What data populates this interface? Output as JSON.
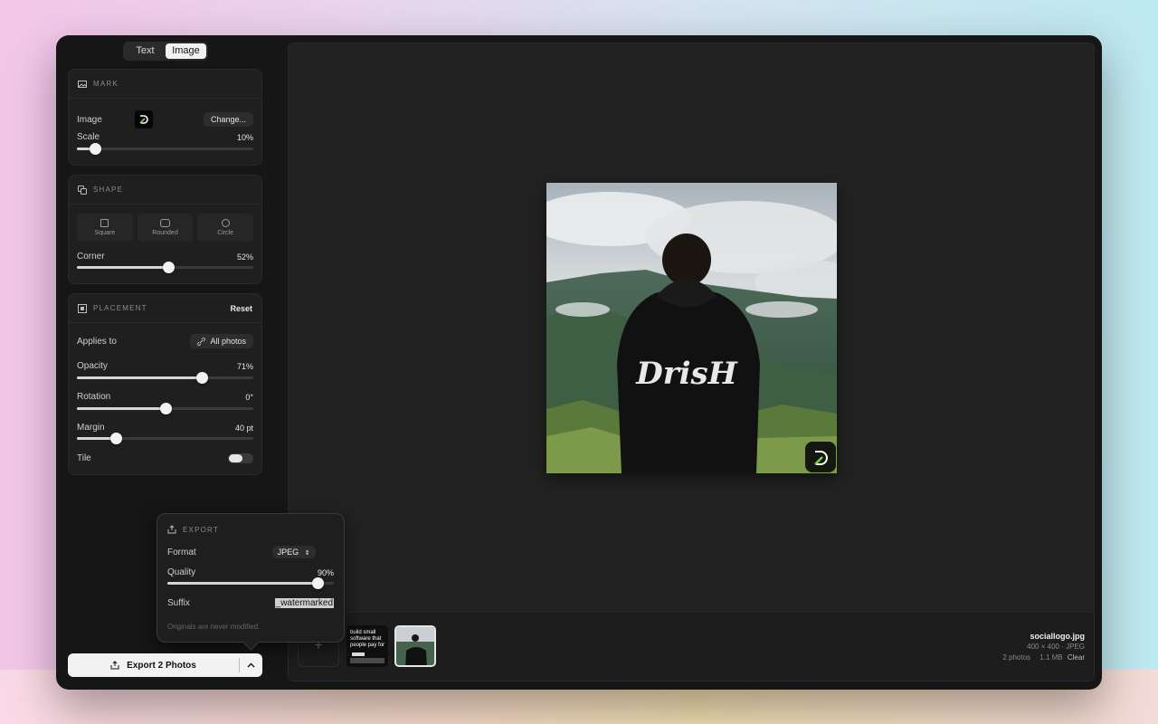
{
  "mode_tabs": [
    "Text",
    "Image"
  ],
  "mark": {
    "header": "MARK",
    "image_label": "Image",
    "change_button": "Change...",
    "scale_label": "Scale",
    "scale_value": "10%",
    "scale_fraction": 0.1
  },
  "shape": {
    "header": "SHAPE",
    "options": [
      "Square",
      "Rounded",
      "Circle"
    ],
    "corner_label": "Corner",
    "corner_value": "52%",
    "corner_fraction": 0.52
  },
  "placement": {
    "header": "PLACEMENT",
    "reset_button": "Reset",
    "applies_label": "Applies to",
    "applies_value": "All photos",
    "opacity_label": "Opacity",
    "opacity_value": "71%",
    "opacity_fraction": 0.71,
    "rotation_label": "Rotation",
    "rotation_value": "0°",
    "rotation_fraction": 0.5,
    "margin_label": "Margin",
    "margin_value": "40 pt",
    "margin_fraction": 0.22,
    "tile_label": "Tile"
  },
  "export_popover": {
    "header": "EXPORT",
    "format_label": "Format",
    "format_value": "JPEG",
    "quality_label": "Quality",
    "quality_value": "90%",
    "quality_fraction": 0.9,
    "suffix_label": "Suffix",
    "suffix_value": "_watermarked",
    "note": "Originals are never modified."
  },
  "export_button": "Export 2 Photos",
  "preview": {
    "hoodie_text": "DrisH"
  },
  "thumb_text": "build small software that people pay for",
  "file_info": {
    "filename": "sociallogo.jpg",
    "dimensions": "400 × 400",
    "format": "JPEG",
    "photos": "2 photos",
    "size": "1.1 MB",
    "clear": "Clear"
  }
}
